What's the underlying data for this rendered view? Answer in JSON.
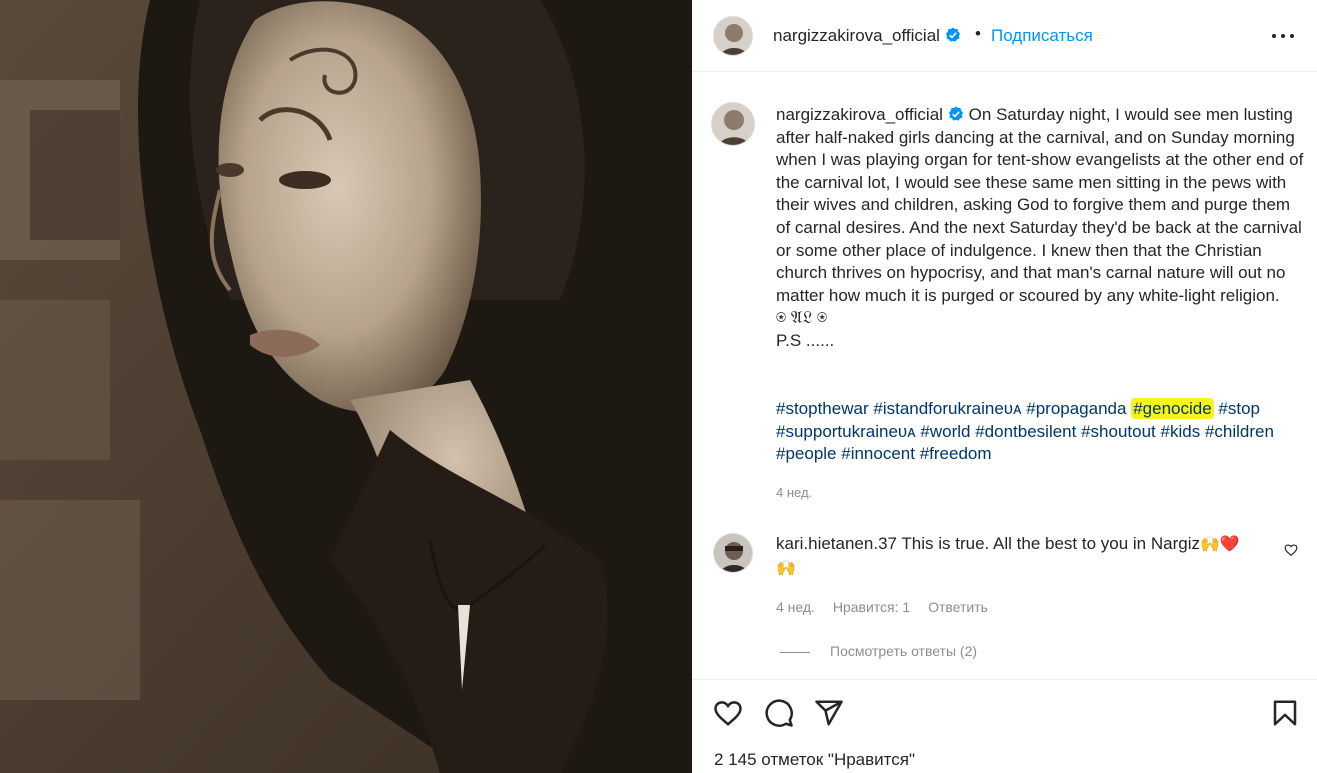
{
  "post": {
    "username": "nargizzakirova_official",
    "separator": "•",
    "follow_label": "Подписаться",
    "caption": "On Saturday night, I would see men lusting after half-naked girls dancing at the carnival, and on Sunday morning when I was playing organ for tent-show evangelists at the other end of the carnival lot, I would see these same men sitting in the pews with their wives and children, asking God to forgive them and purge them of carnal desires. And the next Saturday they'd be back at the carnival or some other place of indulgence. I knew then that the Christian church thrives on hypocrisy, and that man's carnal nature will out no matter how much it is purged or scoured by any white-light religion.",
    "signature": "⍟ 𝔄𝔏 ⍟",
    "ps": "P.S ......",
    "hashtags": [
      "#stopthewar",
      "#istandforukraineᴜᴀ",
      "#propaganda",
      "#genocide",
      "#stop",
      "#supportukraineᴜᴀ",
      "#world",
      "#dontbesilent",
      "#shoutout",
      "#kids",
      "#children",
      "#people",
      "#innocent",
      "#freedom"
    ],
    "highlighted_tag": "#genocide",
    "time": "4 нед.",
    "likes_text": "2 145 отметок \"Нравится\""
  },
  "comment": {
    "username": "kari.hietanen.37",
    "text": "This is true. All the best to you in Nargiz",
    "emoji_1": "🙌",
    "emoji_2": "❤️",
    "emoji_3": "🙌",
    "time": "4 нед.",
    "likes": "Нравится: 1",
    "reply_label": "Ответить",
    "view_replies": "Посмотреть ответы (2)"
  },
  "colors": {
    "accent_blue": "#0095f6",
    "hashtag": "#00376b",
    "highlight": "#f7f31f",
    "meta_gray": "#8e8e8e"
  },
  "icons": [
    "verified-badge-icon",
    "more-options-icon",
    "heart-icon",
    "comment-icon",
    "share-icon",
    "bookmark-icon"
  ]
}
